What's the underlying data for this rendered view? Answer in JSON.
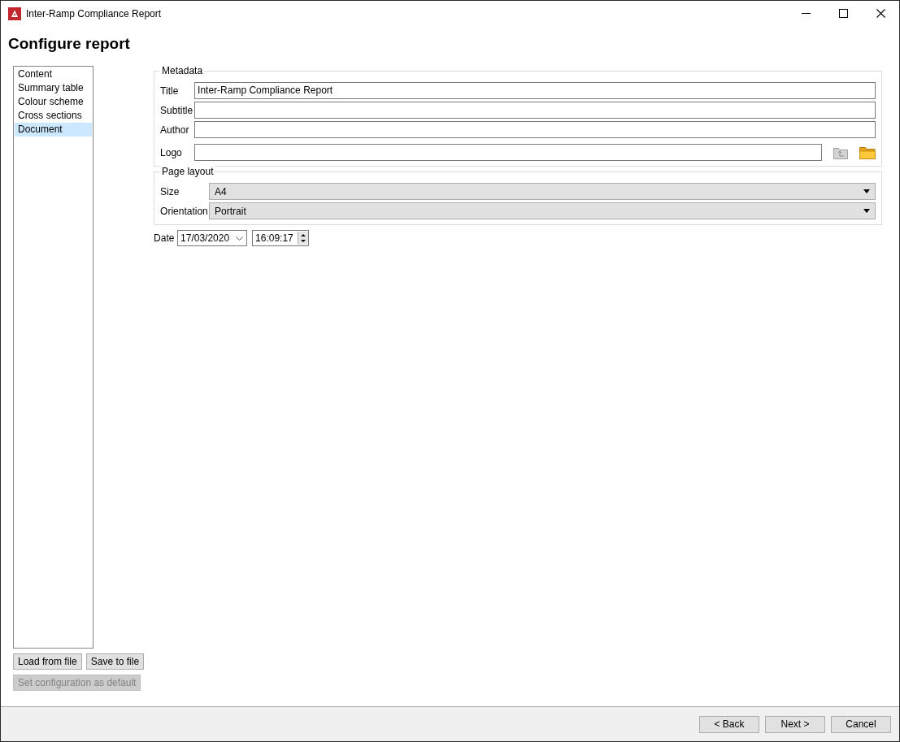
{
  "window": {
    "title": "Inter-Ramp Compliance Report"
  },
  "heading": "Configure report",
  "sidebar": {
    "items": [
      {
        "label": "Content",
        "selected": false
      },
      {
        "label": "Summary table",
        "selected": false
      },
      {
        "label": "Colour scheme",
        "selected": false
      },
      {
        "label": "Cross sections",
        "selected": false
      },
      {
        "label": "Document",
        "selected": true
      }
    ]
  },
  "metadata": {
    "legend": "Metadata",
    "fields": [
      {
        "kind": "text",
        "label": "Title",
        "value": "Inter-Ramp Compliance Report"
      },
      {
        "kind": "text",
        "label": "Subtitle"
      },
      {
        "kind": "text",
        "label": "Author"
      },
      {
        "kind": "file",
        "label": "Logo"
      }
    ]
  },
  "page_layout": {
    "legend": "Page layout",
    "fields": [
      {
        "label": "Size",
        "value": "A4"
      },
      {
        "label": "Orientation",
        "value": "Portrait"
      }
    ]
  },
  "date": {
    "label": "Date",
    "date": "17/03/2020",
    "time": "16:09:17"
  },
  "config_buttons": [
    [
      {
        "label": "Load from file",
        "disabled": false
      },
      {
        "label": "Save to file",
        "disabled": false
      }
    ],
    [
      {
        "label": "Set configuration as default",
        "disabled": true
      }
    ]
  ],
  "footer_buttons": [
    {
      "label": "< Back"
    },
    {
      "label": "Next >"
    },
    {
      "label": "Cancel"
    }
  ]
}
